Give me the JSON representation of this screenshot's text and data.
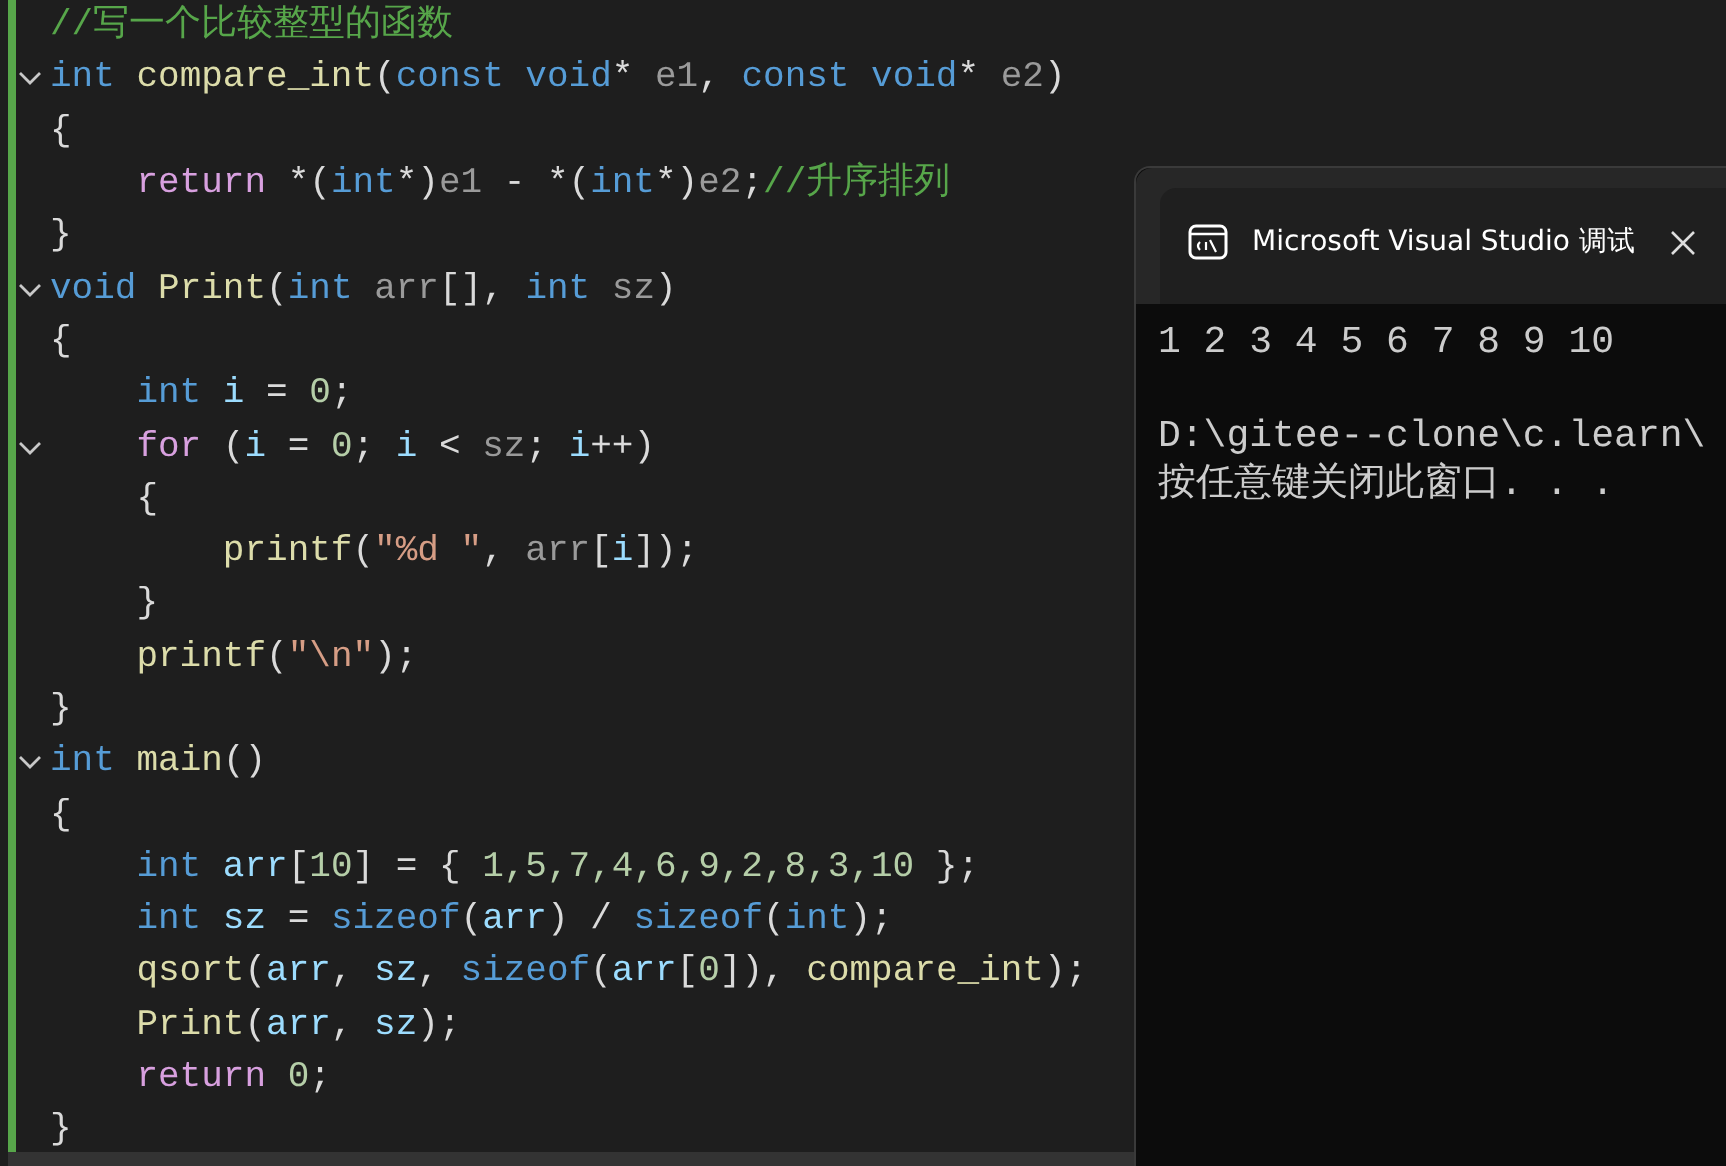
{
  "editor": {
    "lines": [
      {
        "foldable": false,
        "tokens": [
          {
            "kind": "comment",
            "text": "//写一个比较整型的函数"
          }
        ]
      },
      {
        "foldable": true,
        "tokens": [
          {
            "kind": "keyword",
            "text": "int "
          },
          {
            "kind": "function",
            "text": "compare_int"
          },
          {
            "kind": "plain",
            "text": "("
          },
          {
            "kind": "keyword",
            "text": "const void"
          },
          {
            "kind": "plain",
            "text": "* "
          },
          {
            "kind": "param",
            "text": "e1"
          },
          {
            "kind": "plain",
            "text": ", "
          },
          {
            "kind": "keyword",
            "text": "const void"
          },
          {
            "kind": "plain",
            "text": "* "
          },
          {
            "kind": "param",
            "text": "e2"
          },
          {
            "kind": "plain",
            "text": ")"
          }
        ]
      },
      {
        "foldable": false,
        "tokens": [
          {
            "kind": "plain",
            "text": "{"
          }
        ]
      },
      {
        "foldable": false,
        "tokens": [
          {
            "kind": "control",
            "text": "    return"
          },
          {
            "kind": "plain",
            "text": " *("
          },
          {
            "kind": "keyword",
            "text": "int"
          },
          {
            "kind": "plain",
            "text": "*)"
          },
          {
            "kind": "param",
            "text": "e1"
          },
          {
            "kind": "plain",
            "text": " - *("
          },
          {
            "kind": "keyword",
            "text": "int"
          },
          {
            "kind": "plain",
            "text": "*)"
          },
          {
            "kind": "param",
            "text": "e2"
          },
          {
            "kind": "plain",
            "text": ";"
          },
          {
            "kind": "comment",
            "text": "//升序排列"
          }
        ]
      },
      {
        "foldable": false,
        "tokens": [
          {
            "kind": "plain",
            "text": "}"
          }
        ]
      },
      {
        "foldable": true,
        "tokens": [
          {
            "kind": "keyword",
            "text": "void "
          },
          {
            "kind": "function",
            "text": "Print"
          },
          {
            "kind": "plain",
            "text": "("
          },
          {
            "kind": "keyword",
            "text": "int "
          },
          {
            "kind": "param",
            "text": "arr"
          },
          {
            "kind": "plain",
            "text": "[], "
          },
          {
            "kind": "keyword",
            "text": "int "
          },
          {
            "kind": "param",
            "text": "sz"
          },
          {
            "kind": "plain",
            "text": ")"
          }
        ]
      },
      {
        "foldable": false,
        "tokens": [
          {
            "kind": "plain",
            "text": "{"
          }
        ]
      },
      {
        "foldable": false,
        "tokens": [
          {
            "kind": "keyword",
            "text": "    int "
          },
          {
            "kind": "local",
            "text": "i"
          },
          {
            "kind": "plain",
            "text": " = "
          },
          {
            "kind": "number",
            "text": "0"
          },
          {
            "kind": "plain",
            "text": ";"
          }
        ]
      },
      {
        "foldable": true,
        "tokens": [
          {
            "kind": "control",
            "text": "    for"
          },
          {
            "kind": "plain",
            "text": " ("
          },
          {
            "kind": "local",
            "text": "i"
          },
          {
            "kind": "plain",
            "text": " = "
          },
          {
            "kind": "number",
            "text": "0"
          },
          {
            "kind": "plain",
            "text": "; "
          },
          {
            "kind": "local",
            "text": "i"
          },
          {
            "kind": "plain",
            "text": " < "
          },
          {
            "kind": "param",
            "text": "sz"
          },
          {
            "kind": "plain",
            "text": "; "
          },
          {
            "kind": "local",
            "text": "i"
          },
          {
            "kind": "plain",
            "text": "++)"
          }
        ]
      },
      {
        "foldable": false,
        "tokens": [
          {
            "kind": "plain",
            "text": "    {"
          }
        ]
      },
      {
        "foldable": false,
        "tokens": [
          {
            "kind": "function",
            "text": "        printf"
          },
          {
            "kind": "plain",
            "text": "("
          },
          {
            "kind": "string",
            "text": "\"%d \""
          },
          {
            "kind": "plain",
            "text": ", "
          },
          {
            "kind": "param",
            "text": "arr"
          },
          {
            "kind": "plain",
            "text": "["
          },
          {
            "kind": "local",
            "text": "i"
          },
          {
            "kind": "plain",
            "text": "]);"
          }
        ]
      },
      {
        "foldable": false,
        "tokens": [
          {
            "kind": "plain",
            "text": "    }"
          }
        ]
      },
      {
        "foldable": false,
        "tokens": [
          {
            "kind": "function",
            "text": "    printf"
          },
          {
            "kind": "plain",
            "text": "("
          },
          {
            "kind": "string",
            "text": "\"\\n\""
          },
          {
            "kind": "plain",
            "text": ");"
          }
        ]
      },
      {
        "foldable": false,
        "tokens": [
          {
            "kind": "plain",
            "text": "}"
          }
        ]
      },
      {
        "foldable": true,
        "tokens": [
          {
            "kind": "keyword",
            "text": "int "
          },
          {
            "kind": "function",
            "text": "main"
          },
          {
            "kind": "plain",
            "text": "()"
          }
        ]
      },
      {
        "foldable": false,
        "tokens": [
          {
            "kind": "plain",
            "text": "{"
          }
        ]
      },
      {
        "foldable": false,
        "tokens": [
          {
            "kind": "keyword",
            "text": "    int "
          },
          {
            "kind": "local",
            "text": "arr"
          },
          {
            "kind": "plain",
            "text": "["
          },
          {
            "kind": "number",
            "text": "10"
          },
          {
            "kind": "plain",
            "text": "] = { "
          },
          {
            "kind": "number",
            "text": "1,5,7,4,6,9,2,8,3,10"
          },
          {
            "kind": "plain",
            "text": " };"
          }
        ]
      },
      {
        "foldable": false,
        "tokens": [
          {
            "kind": "keyword",
            "text": "    int "
          },
          {
            "kind": "local",
            "text": "sz"
          },
          {
            "kind": "plain",
            "text": " = "
          },
          {
            "kind": "keyword",
            "text": "sizeof"
          },
          {
            "kind": "plain",
            "text": "("
          },
          {
            "kind": "local",
            "text": "arr"
          },
          {
            "kind": "plain",
            "text": ") / "
          },
          {
            "kind": "keyword",
            "text": "sizeof"
          },
          {
            "kind": "plain",
            "text": "("
          },
          {
            "kind": "keyword",
            "text": "int"
          },
          {
            "kind": "plain",
            "text": ");"
          }
        ]
      },
      {
        "foldable": false,
        "tokens": [
          {
            "kind": "function",
            "text": "    qsort"
          },
          {
            "kind": "plain",
            "text": "("
          },
          {
            "kind": "local",
            "text": "arr"
          },
          {
            "kind": "plain",
            "text": ", "
          },
          {
            "kind": "local",
            "text": "sz"
          },
          {
            "kind": "plain",
            "text": ", "
          },
          {
            "kind": "keyword",
            "text": "sizeof"
          },
          {
            "kind": "plain",
            "text": "("
          },
          {
            "kind": "local",
            "text": "arr"
          },
          {
            "kind": "plain",
            "text": "["
          },
          {
            "kind": "number",
            "text": "0"
          },
          {
            "kind": "plain",
            "text": "]), "
          },
          {
            "kind": "function",
            "text": "compare_int"
          },
          {
            "kind": "plain",
            "text": ");"
          }
        ]
      },
      {
        "foldable": false,
        "tokens": [
          {
            "kind": "function",
            "text": "    Print"
          },
          {
            "kind": "plain",
            "text": "("
          },
          {
            "kind": "local",
            "text": "arr"
          },
          {
            "kind": "plain",
            "text": ", "
          },
          {
            "kind": "local",
            "text": "sz"
          },
          {
            "kind": "plain",
            "text": ");"
          }
        ]
      },
      {
        "foldable": false,
        "tokens": [
          {
            "kind": "control",
            "text": "    return "
          },
          {
            "kind": "number",
            "text": "0"
          },
          {
            "kind": "plain",
            "text": ";"
          }
        ]
      },
      {
        "foldable": false,
        "tokens": [
          {
            "kind": "plain",
            "text": "}"
          }
        ]
      }
    ]
  },
  "console": {
    "title": "Microsoft Visual Studio 调试",
    "output_blocks": [
      [
        "1 2 3 4 5 6 7 8 9 10"
      ],
      [
        "D:\\gitee--clone\\c.learn\\",
        "按任意键关闭此窗口. . ."
      ]
    ]
  }
}
